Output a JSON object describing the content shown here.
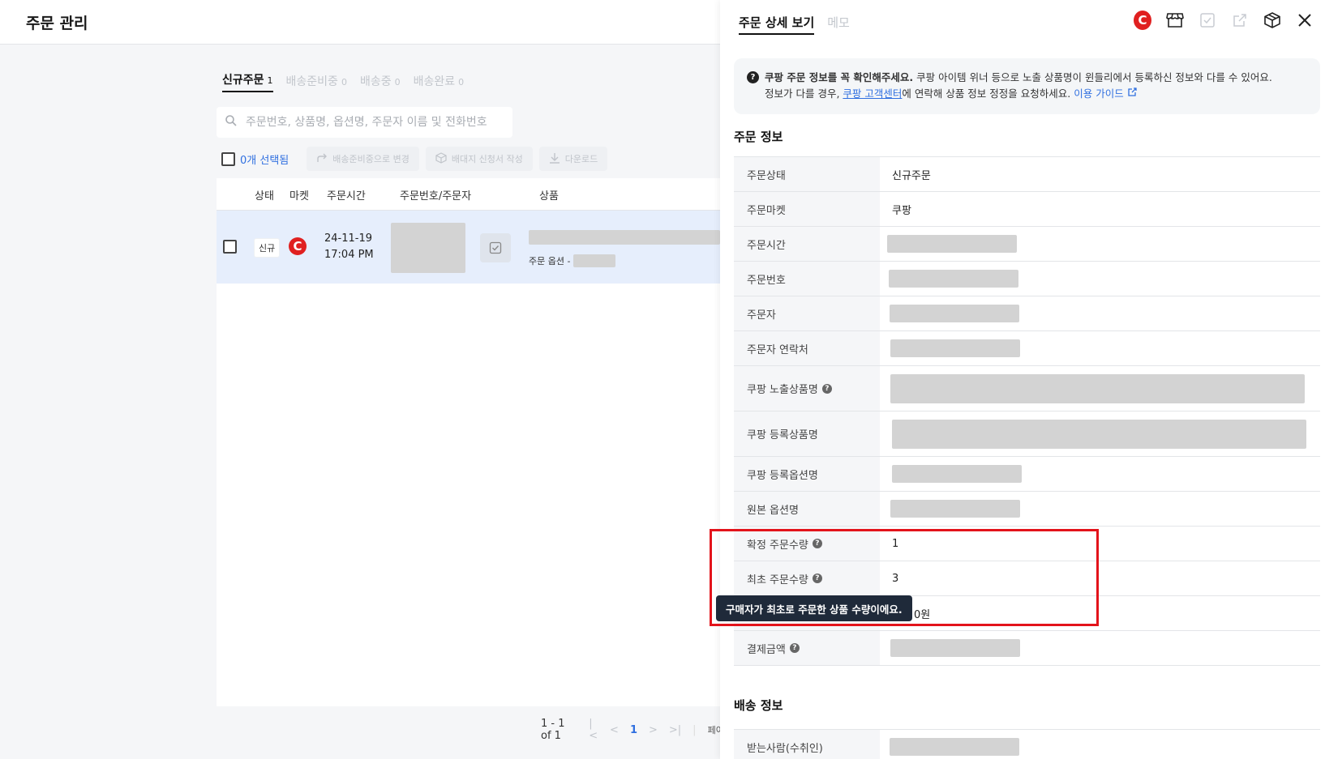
{
  "page": {
    "title": "주문 관리"
  },
  "tabs": [
    {
      "label": "신규주문",
      "count": "1"
    },
    {
      "label": "배송준비중",
      "count": "0"
    },
    {
      "label": "배송중",
      "count": "0"
    },
    {
      "label": "배송완료",
      "count": "0"
    }
  ],
  "search": {
    "placeholder": "주문번호, 상품명, 옵션명, 주문자 이름 및 전화번호"
  },
  "actions": {
    "selected": "0개 선택됨",
    "change_status": "배송준비중으로 변경",
    "invoice": "배대지 신청서 작성",
    "download": "다운로드"
  },
  "table": {
    "headers": [
      "상태",
      "마켓",
      "주문시간",
      "주문번호/주문자",
      "상품"
    ],
    "row": {
      "status": "신규",
      "market_letter": "C",
      "date": "24-11-19",
      "time": "17:04 PM",
      "option_label": "주문 옵션 -"
    }
  },
  "pager": {
    "range": "1 - 1 of 1",
    "page": "1",
    "page_label": "페이지"
  },
  "panel": {
    "tabs": [
      "주문 상세 보기",
      "메모"
    ],
    "notice": {
      "bold": "쿠팡 주문 정보를 꼭 확인해주세요.",
      "text1": " 쿠팡 아이템 위너 등으로 노출 상품명이 윈들리에서 등록하신 정보와 다를 수 있어요.",
      "text2_pre": "정보가 다를 경우, ",
      "link": "쿠팡 고객센터",
      "text2_post": "에 연락해 상품 정보 정정을 요청하세요. ",
      "guide": "이용 가이드"
    },
    "order_info_title": "주문 정보",
    "order_rows": [
      {
        "label": "주문상태",
        "value": "신규주문"
      },
      {
        "label": "주문마켓",
        "value": "쿠팡"
      },
      {
        "label": "주문시간",
        "value": ""
      },
      {
        "label": "주문번호",
        "value": ""
      },
      {
        "label": "주문자",
        "value": ""
      },
      {
        "label": "주문자 연락처",
        "value": ""
      },
      {
        "label": "쿠팡 노출상품명",
        "value": ""
      },
      {
        "label": "쿠팡 등록상품명",
        "value": ""
      },
      {
        "label": "쿠팡 등록옵션명",
        "value": ""
      },
      {
        "label": "원본 옵션명",
        "value": ""
      },
      {
        "label": "확정 주문수량",
        "value": "1"
      },
      {
        "label": "최초 주문수량",
        "value": "3"
      },
      {
        "label": "",
        "value": "0원"
      },
      {
        "label": "결제금액",
        "value": ""
      }
    ],
    "shipping_title": "배송 정보",
    "shipping_rows": [
      {
        "label": "받는사람(수취인)",
        "value": ""
      }
    ],
    "tooltip": "구매자가 최초로 주문한 상품 수량이에요."
  }
}
